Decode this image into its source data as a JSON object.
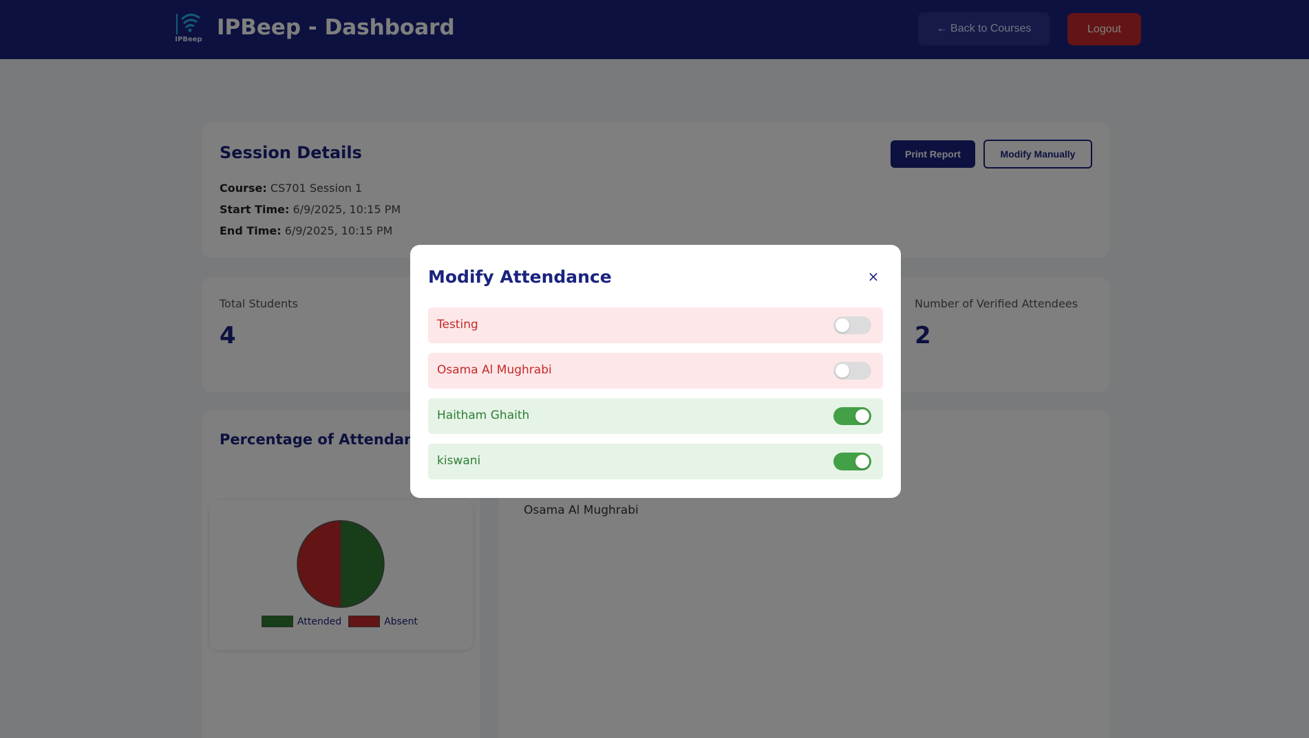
{
  "header": {
    "logo_text": "IPBeep",
    "title": "IPBeep - Dashboard",
    "back_label": "← Back to Courses",
    "logout_label": "Logout"
  },
  "session": {
    "heading": "Session Details",
    "course_label": "Course:",
    "course_value": "CS701 Session 1",
    "start_label": "Start Time:",
    "start_value": "6/9/2025, 10:15 PM",
    "end_label": "End Time:",
    "end_value": "6/9/2025, 10:15 PM",
    "print_label": "Print Report",
    "modify_label": "Modify Manually"
  },
  "stats": {
    "total_label": "Total Students",
    "total_value": "4",
    "verified_label": "Number of Verified Attendees",
    "verified_value": "2"
  },
  "chart_section": {
    "heading": "Percentage of Attendance"
  },
  "chart_data": {
    "type": "pie",
    "categories": [
      "Attended",
      "Absent"
    ],
    "values": [
      2,
      2
    ],
    "colors": [
      "#2e7d32",
      "#c62828"
    ],
    "legend": "bottom"
  },
  "list_section": {
    "visible_name": "Osama Al Mughrabi"
  },
  "modal": {
    "title": "Modify Attendance",
    "close_label": "×",
    "students": [
      {
        "name": "Testing",
        "present": false
      },
      {
        "name": "Osama Al Mughrabi",
        "present": false
      },
      {
        "name": "Haitham Ghaith",
        "present": true
      },
      {
        "name": "kiswani",
        "present": true
      }
    ]
  },
  "colors": {
    "brand": "#1a237e",
    "danger": "#c62828",
    "success": "#43a047"
  }
}
